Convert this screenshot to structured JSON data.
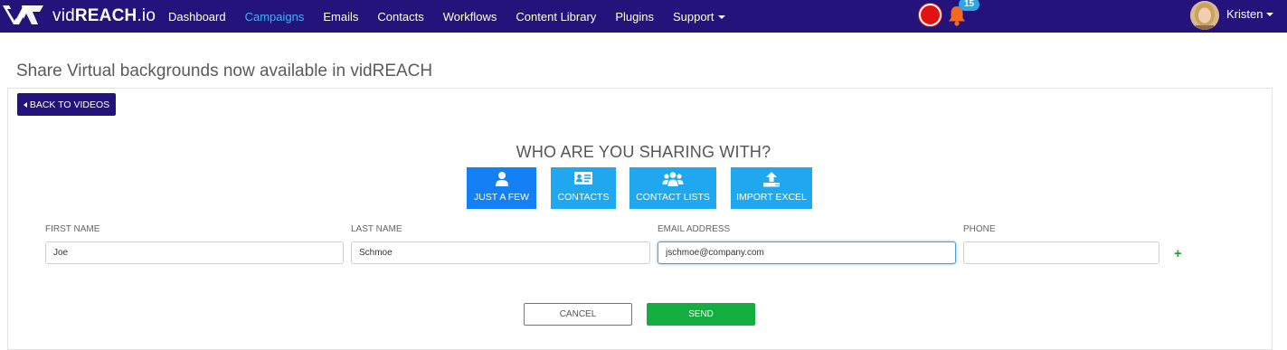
{
  "app": {
    "logo_prefix": "vid",
    "logo_bold": "REACH",
    "logo_suffix": ".io"
  },
  "nav": {
    "items": [
      "Dashboard",
      "Campaigns",
      "Emails",
      "Contacts",
      "Workflows",
      "Content Library",
      "Plugins",
      "Support"
    ],
    "active": "Campaigns",
    "dropdown_item": "Support"
  },
  "header_right": {
    "notification_count": "15",
    "user_name": "Kristen"
  },
  "page": {
    "title": "Share Virtual backgrounds now available in vidREACH",
    "back_button": "BACK TO VIDEOS",
    "share_heading": "WHO ARE YOU SHARING WITH?"
  },
  "share_options": [
    {
      "label": "JUST A FEW",
      "icon": "user-icon",
      "selected": true
    },
    {
      "label": "CONTACTS",
      "icon": "contact-card-icon",
      "selected": false
    },
    {
      "label": "CONTACT LISTS",
      "icon": "users-group-icon",
      "selected": false
    },
    {
      "label": "IMPORT EXCEL",
      "icon": "upload-icon",
      "selected": false
    }
  ],
  "form": {
    "first_name_label": "FIRST NAME",
    "first_name_value": "Joe",
    "last_name_label": "LAST NAME",
    "last_name_value": "Schmoe",
    "email_label": "EMAIL ADDRESS",
    "email_value": "jschmoe@company.com",
    "phone_label": "PHONE",
    "phone_value": "",
    "add_symbol": "+"
  },
  "actions": {
    "cancel": "CANCEL",
    "send": "SEND"
  },
  "colors": {
    "navbar": "#23137a",
    "nav_active": "#3fb3ff",
    "share_option": "#1fa8f0",
    "share_option_selected": "#1380f5",
    "send": "#13ad40",
    "record": "#e01212",
    "bell": "#f26a21",
    "badge": "#2aa6e8"
  }
}
